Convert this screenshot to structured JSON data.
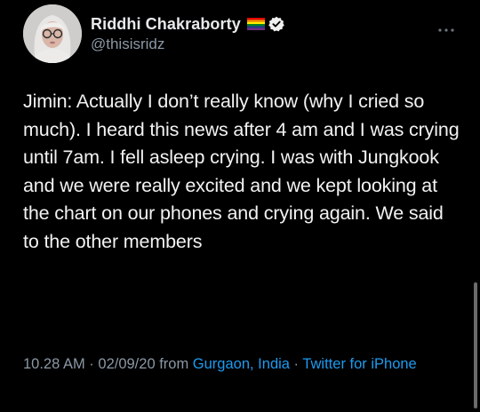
{
  "user": {
    "display_name": "Riddhi Chakraborty",
    "handle": "@thisisridz",
    "badges": [
      "rainbow-flag-icon",
      "verified-icon"
    ]
  },
  "tweet": {
    "text": "Jimin: Actually I don’t really know (why I cried so much). I heard this news after 4 am and I was crying until 7am. I fell asleep crying. I was with Jungkook and we were really excited and we kept looking at the chart on our phones and crying again. We said to the other members"
  },
  "meta": {
    "time": "10.28 AM",
    "separator1": " · ",
    "date": "02/09/20",
    "from_label": " from ",
    "location": "Gurgaon, India",
    "separator2": " · ",
    "source": "Twitter for iPhone"
  },
  "colors": {
    "background": "#000000",
    "text": "#e7e9ea",
    "secondary": "#8b98a5",
    "link": "#1d9bf0"
  }
}
